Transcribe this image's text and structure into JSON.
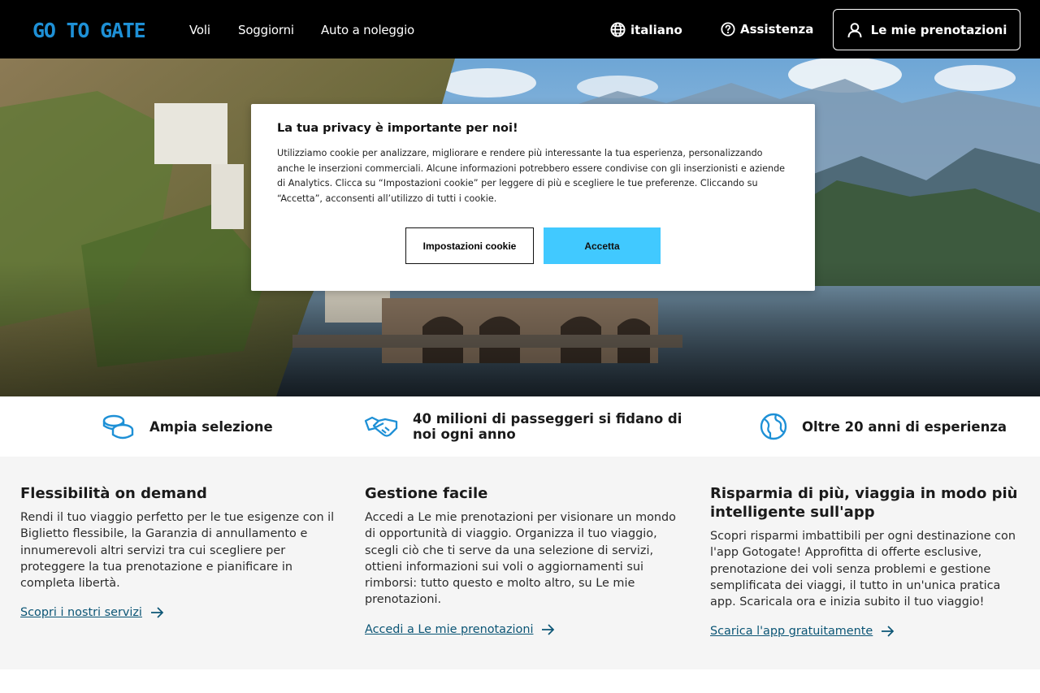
{
  "header": {
    "logo_text": "GO TO GATE",
    "nav": [
      "Voli",
      "Soggiorni",
      "Auto a noleggio"
    ],
    "language": "italiano",
    "help": "Assistenza",
    "my_bookings": "Le mie prenotazioni"
  },
  "cookie_modal": {
    "title": "La tua privacy è importante per noi!",
    "text": "Utilizziamo cookie per analizzare, migliorare e rendere più interessante la tua esperienza, personalizzando anche le inserzioni commerciali. Alcune informazioni potrebbero essere condivise con gli inserzionisti e aziende di Analytics. Clicca su “Impostazioni cookie” per leggere di più e scegliere le tue preferenze. Cliccando su “Accetta”, acconsenti all’utilizzo di tutti i cookie.",
    "settings_button": "Impostazioni cookie",
    "accept_button": "Accetta",
    "accept_color": "#41c9ff"
  },
  "trust_bar": [
    {
      "icon": "coins-icon",
      "text": "Ampia selezione"
    },
    {
      "icon": "handshake-icon",
      "text": "40 milioni di passeggeri si fidano di noi ogni anno"
    },
    {
      "icon": "globe-icon",
      "text": "Oltre 20 anni di esperienza"
    }
  ],
  "features": [
    {
      "title": "Flessibilità on demand",
      "text": "Rendi il tuo viaggio perfetto per le tue esigenze con il Biglietto flessibile, la Garanzia di annullamento e innumerevoli altri servizi tra cui scegliere per proteggere la tua prenotazione e pianificare in completa libertà.",
      "link": "Scopri i nostri servizi"
    },
    {
      "title": "Gestione facile",
      "text": "Accedi a Le mie prenotazioni per visionare un mondo di opportunità di viaggio. Organizza il tuo viaggio, scegli ciò che ti serve da una selezione di servizi, ottieni informazioni sui voli o aggiornamenti sui rimborsi: tutto questo e molto altro, su Le mie prenotazioni.",
      "link": "Accedi a Le mie prenotazioni"
    },
    {
      "title": "Risparmia di più, viaggia in modo più intelligente sull'app",
      "text": "Scopri risparmi imbattibili per ogni destinazione con l'app Gotogate! Approfitta di offerte esclusive, prenotazione dei voli senza problemi e gestione semplificata dei viaggi, il tutto in un'unica pratica app. Scaricala ora e inizia subito il tuo viaggio!",
      "link": "Scarica l'app gratuitamente"
    }
  ],
  "colors": {
    "header_bg": "#000000",
    "logo": "#1e90d6",
    "link": "#0b5575",
    "icon_blue": "#1e90d6",
    "features_bg": "#f5f5f5"
  }
}
